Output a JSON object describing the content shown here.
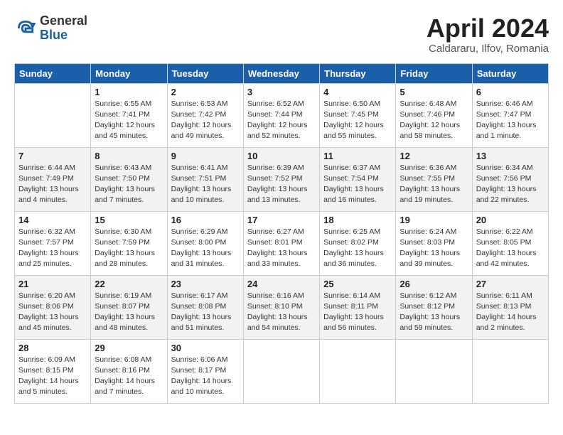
{
  "header": {
    "logo_general": "General",
    "logo_blue": "Blue",
    "month_title": "April 2024",
    "subtitle": "Caldararu, Ilfov, Romania"
  },
  "days_of_week": [
    "Sunday",
    "Monday",
    "Tuesday",
    "Wednesday",
    "Thursday",
    "Friday",
    "Saturday"
  ],
  "weeks": [
    [
      {
        "num": "",
        "sunrise": "",
        "sunset": "",
        "daylight": ""
      },
      {
        "num": "1",
        "sunrise": "Sunrise: 6:55 AM",
        "sunset": "Sunset: 7:41 PM",
        "daylight": "Daylight: 12 hours and 45 minutes."
      },
      {
        "num": "2",
        "sunrise": "Sunrise: 6:53 AM",
        "sunset": "Sunset: 7:42 PM",
        "daylight": "Daylight: 12 hours and 49 minutes."
      },
      {
        "num": "3",
        "sunrise": "Sunrise: 6:52 AM",
        "sunset": "Sunset: 7:44 PM",
        "daylight": "Daylight: 12 hours and 52 minutes."
      },
      {
        "num": "4",
        "sunrise": "Sunrise: 6:50 AM",
        "sunset": "Sunset: 7:45 PM",
        "daylight": "Daylight: 12 hours and 55 minutes."
      },
      {
        "num": "5",
        "sunrise": "Sunrise: 6:48 AM",
        "sunset": "Sunset: 7:46 PM",
        "daylight": "Daylight: 12 hours and 58 minutes."
      },
      {
        "num": "6",
        "sunrise": "Sunrise: 6:46 AM",
        "sunset": "Sunset: 7:47 PM",
        "daylight": "Daylight: 13 hours and 1 minute."
      }
    ],
    [
      {
        "num": "7",
        "sunrise": "Sunrise: 6:44 AM",
        "sunset": "Sunset: 7:49 PM",
        "daylight": "Daylight: 13 hours and 4 minutes."
      },
      {
        "num": "8",
        "sunrise": "Sunrise: 6:43 AM",
        "sunset": "Sunset: 7:50 PM",
        "daylight": "Daylight: 13 hours and 7 minutes."
      },
      {
        "num": "9",
        "sunrise": "Sunrise: 6:41 AM",
        "sunset": "Sunset: 7:51 PM",
        "daylight": "Daylight: 13 hours and 10 minutes."
      },
      {
        "num": "10",
        "sunrise": "Sunrise: 6:39 AM",
        "sunset": "Sunset: 7:52 PM",
        "daylight": "Daylight: 13 hours and 13 minutes."
      },
      {
        "num": "11",
        "sunrise": "Sunrise: 6:37 AM",
        "sunset": "Sunset: 7:54 PM",
        "daylight": "Daylight: 13 hours and 16 minutes."
      },
      {
        "num": "12",
        "sunrise": "Sunrise: 6:36 AM",
        "sunset": "Sunset: 7:55 PM",
        "daylight": "Daylight: 13 hours and 19 minutes."
      },
      {
        "num": "13",
        "sunrise": "Sunrise: 6:34 AM",
        "sunset": "Sunset: 7:56 PM",
        "daylight": "Daylight: 13 hours and 22 minutes."
      }
    ],
    [
      {
        "num": "14",
        "sunrise": "Sunrise: 6:32 AM",
        "sunset": "Sunset: 7:57 PM",
        "daylight": "Daylight: 13 hours and 25 minutes."
      },
      {
        "num": "15",
        "sunrise": "Sunrise: 6:30 AM",
        "sunset": "Sunset: 7:59 PM",
        "daylight": "Daylight: 13 hours and 28 minutes."
      },
      {
        "num": "16",
        "sunrise": "Sunrise: 6:29 AM",
        "sunset": "Sunset: 8:00 PM",
        "daylight": "Daylight: 13 hours and 31 minutes."
      },
      {
        "num": "17",
        "sunrise": "Sunrise: 6:27 AM",
        "sunset": "Sunset: 8:01 PM",
        "daylight": "Daylight: 13 hours and 33 minutes."
      },
      {
        "num": "18",
        "sunrise": "Sunrise: 6:25 AM",
        "sunset": "Sunset: 8:02 PM",
        "daylight": "Daylight: 13 hours and 36 minutes."
      },
      {
        "num": "19",
        "sunrise": "Sunrise: 6:24 AM",
        "sunset": "Sunset: 8:03 PM",
        "daylight": "Daylight: 13 hours and 39 minutes."
      },
      {
        "num": "20",
        "sunrise": "Sunrise: 6:22 AM",
        "sunset": "Sunset: 8:05 PM",
        "daylight": "Daylight: 13 hours and 42 minutes."
      }
    ],
    [
      {
        "num": "21",
        "sunrise": "Sunrise: 6:20 AM",
        "sunset": "Sunset: 8:06 PM",
        "daylight": "Daylight: 13 hours and 45 minutes."
      },
      {
        "num": "22",
        "sunrise": "Sunrise: 6:19 AM",
        "sunset": "Sunset: 8:07 PM",
        "daylight": "Daylight: 13 hours and 48 minutes."
      },
      {
        "num": "23",
        "sunrise": "Sunrise: 6:17 AM",
        "sunset": "Sunset: 8:08 PM",
        "daylight": "Daylight: 13 hours and 51 minutes."
      },
      {
        "num": "24",
        "sunrise": "Sunrise: 6:16 AM",
        "sunset": "Sunset: 8:10 PM",
        "daylight": "Daylight: 13 hours and 54 minutes."
      },
      {
        "num": "25",
        "sunrise": "Sunrise: 6:14 AM",
        "sunset": "Sunset: 8:11 PM",
        "daylight": "Daylight: 13 hours and 56 minutes."
      },
      {
        "num": "26",
        "sunrise": "Sunrise: 6:12 AM",
        "sunset": "Sunset: 8:12 PM",
        "daylight": "Daylight: 13 hours and 59 minutes."
      },
      {
        "num": "27",
        "sunrise": "Sunrise: 6:11 AM",
        "sunset": "Sunset: 8:13 PM",
        "daylight": "Daylight: 14 hours and 2 minutes."
      }
    ],
    [
      {
        "num": "28",
        "sunrise": "Sunrise: 6:09 AM",
        "sunset": "Sunset: 8:15 PM",
        "daylight": "Daylight: 14 hours and 5 minutes."
      },
      {
        "num": "29",
        "sunrise": "Sunrise: 6:08 AM",
        "sunset": "Sunset: 8:16 PM",
        "daylight": "Daylight: 14 hours and 7 minutes."
      },
      {
        "num": "30",
        "sunrise": "Sunrise: 6:06 AM",
        "sunset": "Sunset: 8:17 PM",
        "daylight": "Daylight: 14 hours and 10 minutes."
      },
      {
        "num": "",
        "sunrise": "",
        "sunset": "",
        "daylight": ""
      },
      {
        "num": "",
        "sunrise": "",
        "sunset": "",
        "daylight": ""
      },
      {
        "num": "",
        "sunrise": "",
        "sunset": "",
        "daylight": ""
      },
      {
        "num": "",
        "sunrise": "",
        "sunset": "",
        "daylight": ""
      }
    ]
  ]
}
